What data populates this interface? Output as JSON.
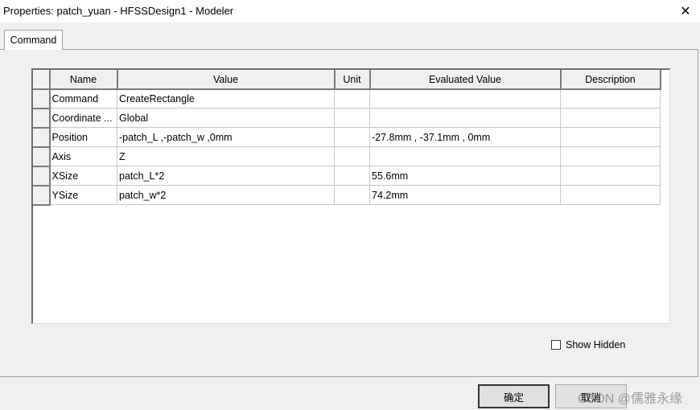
{
  "window": {
    "title": "Properties: patch_yuan - HFSSDesign1 - Modeler",
    "close_glyph": "✕"
  },
  "tabs": [
    {
      "label": "Command"
    }
  ],
  "grid": {
    "columns": [
      "Name",
      "Value",
      "Unit",
      "Evaluated Value",
      "Description"
    ],
    "rows": [
      {
        "name": "Command",
        "value": "CreateRectangle",
        "unit": "",
        "evaluated": "",
        "description": ""
      },
      {
        "name": "Coordinate ...",
        "value": "Global",
        "unit": "",
        "evaluated": "",
        "description": ""
      },
      {
        "name": "Position",
        "value": "-patch_L ,-patch_w ,0mm",
        "unit": "",
        "evaluated": "-27.8mm , -37.1mm , 0mm",
        "description": ""
      },
      {
        "name": "Axis",
        "value": "Z",
        "unit": "",
        "evaluated": "",
        "description": ""
      },
      {
        "name": "XSize",
        "value": "patch_L*2",
        "unit": "",
        "evaluated": "55.6mm",
        "description": ""
      },
      {
        "name": "YSize",
        "value": "patch_w*2",
        "unit": "",
        "evaluated": "74.2mm",
        "description": ""
      }
    ]
  },
  "show_hidden": {
    "label": "Show Hidden",
    "checked": false
  },
  "buttons": {
    "ok": "确定",
    "cancel": "取消"
  },
  "watermark": "CSDN @儒雅永缘"
}
